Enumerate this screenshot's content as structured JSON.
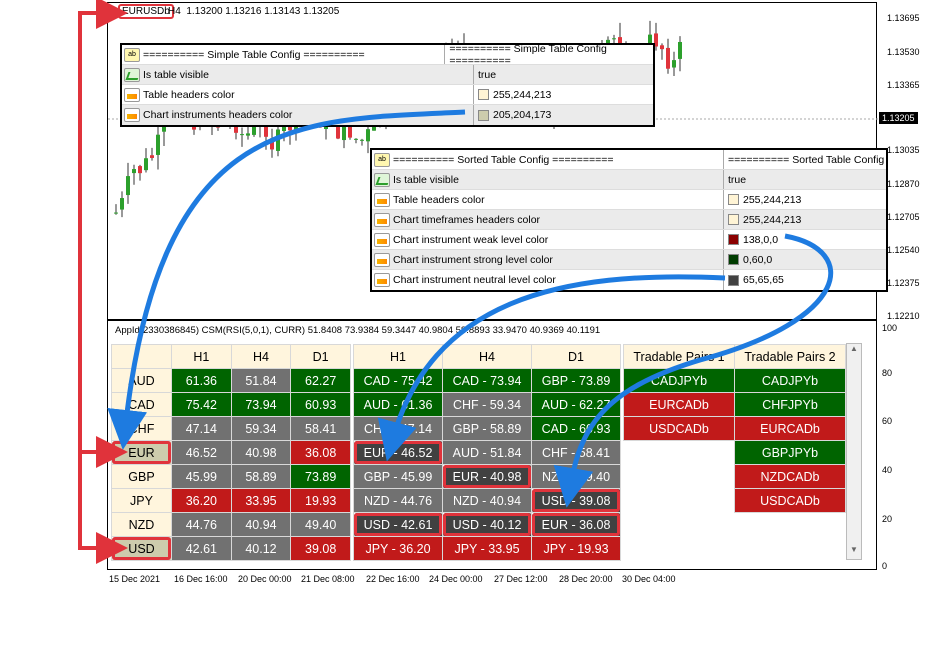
{
  "main_chart": {
    "symbol": "EURUSDb",
    "timeframe": "H4",
    "ohlc": "1.13200 1.13216 1.13143 1.13205",
    "current_price": "1.13205",
    "price_ticks": [
      "1.13695",
      "1.13530",
      "1.13365",
      "1.13035",
      "1.12870",
      "1.12705",
      "1.12540",
      "1.12375",
      "1.12210"
    ]
  },
  "simple_config": {
    "header_left": "========== Simple Table Config ==========",
    "header_right": "========== Simple Table Config ==========",
    "rows": [
      {
        "icon": "toggle-icon",
        "name": "Is table visible",
        "value": "true",
        "swatch": ""
      },
      {
        "icon": "color-icon",
        "name": "Table headers color",
        "value": "255,244,213",
        "swatch": "#fff4d5"
      },
      {
        "icon": "color-icon",
        "name": "Chart instruments headers color",
        "value": "205,204,173",
        "swatch": "#cdccad"
      }
    ]
  },
  "sorted_config": {
    "header_left": "========== Sorted Table Config ==========",
    "header_right": "========== Sorted Table Config",
    "rows": [
      {
        "icon": "toggle-icon",
        "name": "Is table visible",
        "value": "true",
        "swatch": ""
      },
      {
        "icon": "color-icon",
        "name": "Table headers color",
        "value": "255,244,213",
        "swatch": "#fff4d5"
      },
      {
        "icon": "color-icon",
        "name": "Chart timeframes headers color",
        "value": "255,244,213",
        "swatch": "#fff4d5"
      },
      {
        "icon": "color-icon",
        "name": "Chart instrument weak level color",
        "value": "138,0,0",
        "swatch": "#8a0000"
      },
      {
        "icon": "color-icon",
        "name": "Chart instrument strong level color",
        "value": "0,60,0",
        "swatch": "#003c00"
      },
      {
        "icon": "color-icon",
        "name": "Chart instrument neutral level color",
        "value": "65,65,65",
        "swatch": "#414141"
      }
    ]
  },
  "indicator": {
    "info": "AppId(2330386845) CSM(RSI(5,0,1), CURR) 51.8408 73.9384 59.3447 40.9804 58.8893 33.9470 40.9369 40.1191",
    "axis": [
      "100",
      "80",
      "60",
      "40",
      "20",
      "0"
    ]
  },
  "simple_table": {
    "headers": [
      "H1",
      "H4",
      "D1"
    ],
    "rows": [
      {
        "cur": "AUD",
        "vals": [
          "61.36",
          "51.84",
          "62.27"
        ],
        "cls": [
          "grn",
          "neu",
          "grn"
        ]
      },
      {
        "cur": "CAD",
        "vals": [
          "75.42",
          "73.94",
          "60.93"
        ],
        "cls": [
          "grn",
          "grn",
          "grn"
        ]
      },
      {
        "cur": "CHF",
        "vals": [
          "47.14",
          "59.34",
          "58.41"
        ],
        "cls": [
          "neu",
          "neu",
          "neu"
        ]
      },
      {
        "cur": "EUR",
        "vals": [
          "46.52",
          "40.98",
          "36.08"
        ],
        "cls": [
          "neu",
          "neu",
          "red"
        ]
      },
      {
        "cur": "GBP",
        "vals": [
          "45.99",
          "58.89",
          "73.89"
        ],
        "cls": [
          "neu",
          "neu",
          "grn"
        ]
      },
      {
        "cur": "JPY",
        "vals": [
          "36.20",
          "33.95",
          "19.93"
        ],
        "cls": [
          "red",
          "red",
          "red"
        ]
      },
      {
        "cur": "NZD",
        "vals": [
          "44.76",
          "40.94",
          "49.40"
        ],
        "cls": [
          "neu",
          "neu",
          "neu"
        ]
      },
      {
        "cur": "USD",
        "vals": [
          "42.61",
          "40.12",
          "39.08"
        ],
        "cls": [
          "neu",
          "neu",
          "red"
        ]
      }
    ]
  },
  "sorted_table": {
    "headers": [
      "H1",
      "H4",
      "D1"
    ],
    "rows": [
      [
        "CAD - 75.42",
        "CAD - 73.94",
        "GBP - 73.89"
      ],
      [
        "AUD - 61.36",
        "CHF - 59.34",
        "AUD - 62.27"
      ],
      [
        "CHF - 47.14",
        "GBP - 58.89",
        "CAD - 60.93"
      ],
      [
        "EUR - 46.52",
        "AUD - 51.84",
        "CHF - 58.41"
      ],
      [
        "GBP - 45.99",
        "EUR - 40.98",
        "NZD - 49.40"
      ],
      [
        "NZD - 44.76",
        "NZD - 40.94",
        "USD - 39.08"
      ],
      [
        "USD - 42.61",
        "USD - 40.12",
        "EUR - 36.08"
      ],
      [
        "JPY - 36.20",
        "JPY - 33.95",
        "JPY - 19.93"
      ]
    ],
    "cls": [
      [
        "grn",
        "grn",
        "grn"
      ],
      [
        "grn",
        "neu",
        "grn"
      ],
      [
        "neu",
        "neu",
        "grn"
      ],
      [
        "gry",
        "neu",
        "neu"
      ],
      [
        "neu",
        "gry",
        "neu"
      ],
      [
        "neu",
        "neu",
        "gry"
      ],
      [
        "gry",
        "gry",
        "gry"
      ],
      [
        "red",
        "red",
        "red"
      ]
    ]
  },
  "tradable": {
    "header1": "Tradable Pairs 1",
    "header2": "Tradable Pairs 2",
    "col1": [
      {
        "t": "CADJPYb",
        "c": "grn"
      },
      {
        "t": "EURCADb",
        "c": "red"
      },
      {
        "t": "USDCADb",
        "c": "red"
      }
    ],
    "col2": [
      {
        "t": "CADJPYb",
        "c": "grn"
      },
      {
        "t": "CHFJPYb",
        "c": "grn"
      },
      {
        "t": "EURCADb",
        "c": "red"
      },
      {
        "t": "GBPJPYb",
        "c": "grn"
      },
      {
        "t": "NZDCADb",
        "c": "red"
      },
      {
        "t": "USDCADb",
        "c": "red"
      }
    ]
  },
  "time_axis": [
    "15 Dec 2021",
    "16 Dec 16:00",
    "20 Dec 00:00",
    "21 Dec 08:00",
    "22 Dec 16:00",
    "24 Dec 00:00",
    "27 Dec 12:00",
    "28 Dec 20:00",
    "30 Dec 04:00"
  ],
  "colors": {
    "bull": "#2ca02c",
    "bear": "#e0333b",
    "arrow": "#1e7be0",
    "highlight": "#e0333b"
  }
}
